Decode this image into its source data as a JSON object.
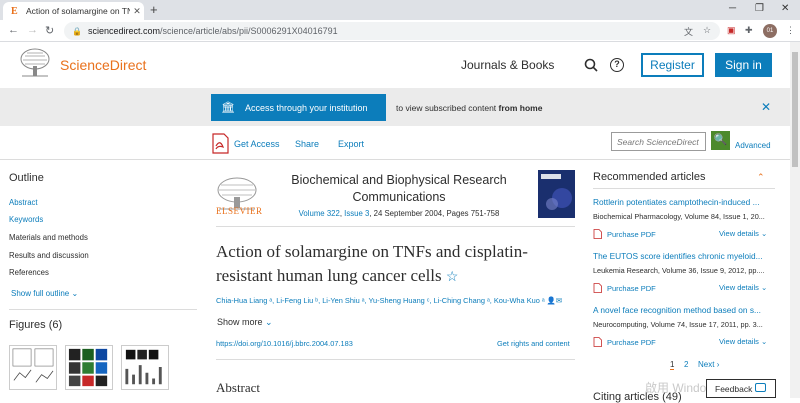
{
  "browser": {
    "tab_title": "Action of solamargine on TNFs a",
    "tab_favicon": "E",
    "url_host": "sciencedirect.com",
    "url_path": "/science/article/abs/pii/S0006291X04016791",
    "profile_initials": "01"
  },
  "header": {
    "brand": "ScienceDirect",
    "journals_books": "Journals & Books",
    "register": "Register",
    "sign_in": "Sign in"
  },
  "banner": {
    "access_button": "Access through your institution",
    "message_prefix": "to view subscribed content",
    "message_bold": "from home"
  },
  "toolbar": {
    "get_access": "Get Access",
    "share": "Share",
    "export": "Export",
    "search_placeholder": "Search ScienceDirect",
    "advanced": "Advanced"
  },
  "outline": {
    "heading": "Outline",
    "items": [
      {
        "label": "Abstract"
      },
      {
        "label": "Keywords"
      },
      {
        "label": "Materials and methods"
      },
      {
        "label": "Results and discussion"
      },
      {
        "label": "References"
      }
    ],
    "show_full": "Show full outline",
    "figures_heading": "Figures (6)"
  },
  "article": {
    "publisher": "ELSEVIER",
    "journal_line1": "Biochemical and Biophysical Research",
    "journal_line2": "Communications",
    "volume": "Volume 322",
    "issue": "Issue 3",
    "date_pages": ", 24 September 2004, Pages 751-758",
    "title": "Action of solamargine on TNFs and cisplatin-resistant human lung cancer cells",
    "authors": "Chia-Hua Liang ᵃ, Li-Feng Liu ᵇ, Li-Yen Shiu ᵃ, Yu-Sheng Huang ᶜ, Li-Ching Chang ᵃ, Kou-Wha Kuo ᵃ",
    "show_more": "Show more",
    "doi": "https://doi.org/10.1016/j.bbrc.2004.07.183",
    "rights": "Get rights and content",
    "abstract_heading": "Abstract"
  },
  "recommended": {
    "heading": "Recommended articles",
    "purchase_label": "Purchase PDF",
    "details_label": "View details",
    "items": [
      {
        "title": "Rottlerin potentiates camptothecin-induced ...",
        "source": "Biochemical Pharmacology, Volume 84, Issue 1, 20..."
      },
      {
        "title": "The EUTOS score identifies chronic myeloid...",
        "source": "Leukemia Research, Volume 36, Issue 9, 2012, pp...."
      },
      {
        "title": "A novel face recognition method based on s...",
        "source": "Neurocomputing, Volume 74, Issue 17, 2011, pp. 3..."
      }
    ],
    "page1": "1",
    "page2": "2",
    "next": "Next",
    "citing_heading": "Citing articles (49)"
  },
  "overlay": {
    "watermark": "啟用 Windows",
    "feedback": "Feedback"
  }
}
